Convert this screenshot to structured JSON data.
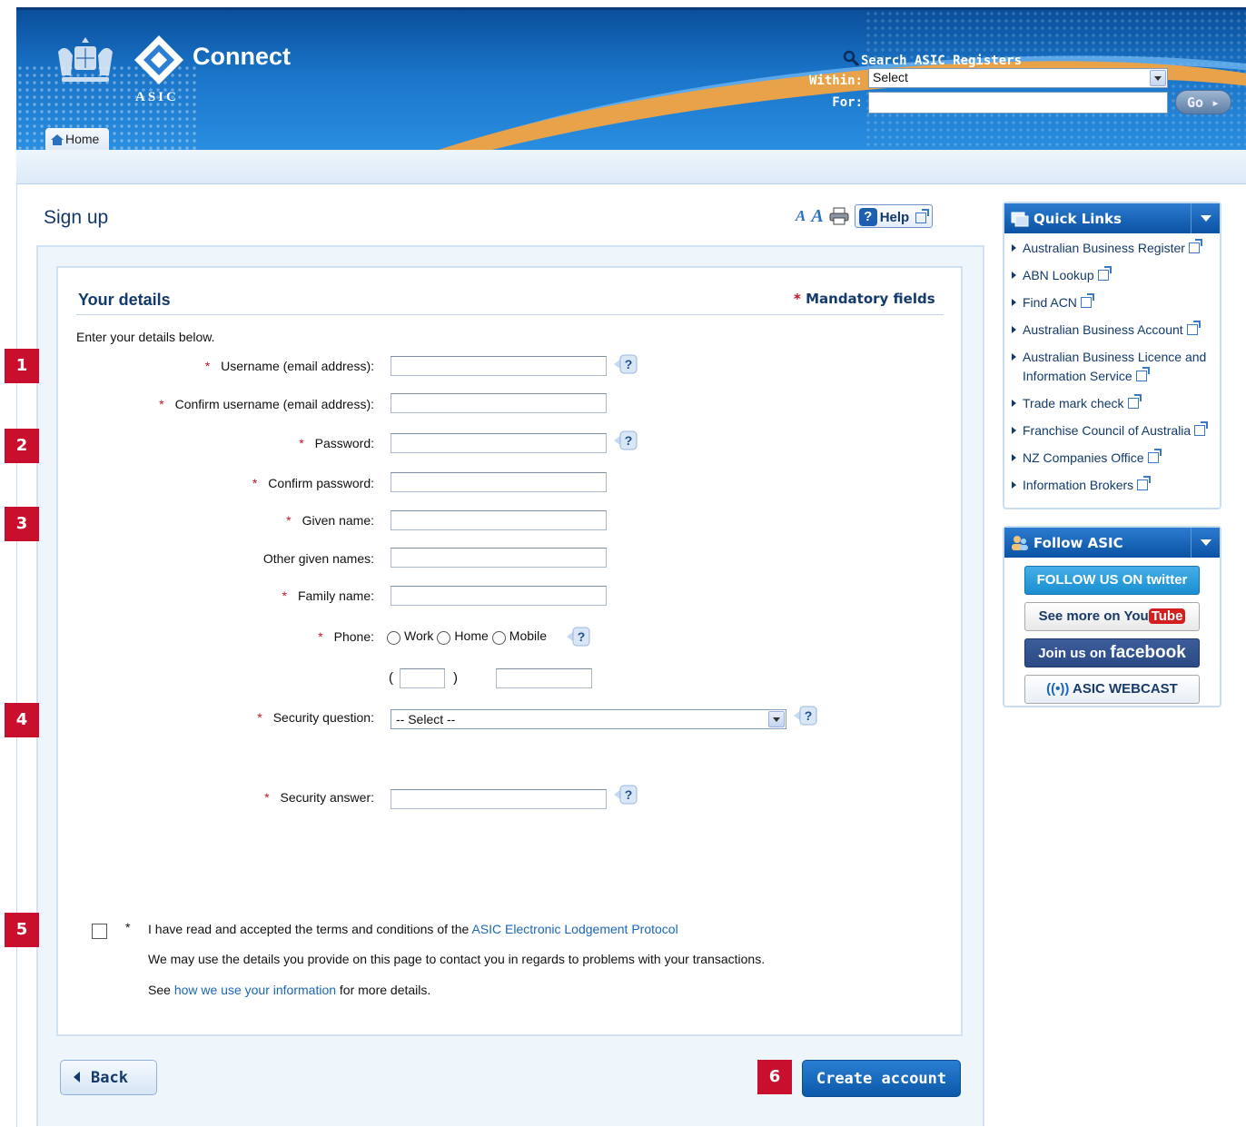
{
  "header": {
    "app_title": "Connect",
    "org": "ASIC",
    "home_tab": "Home",
    "search": {
      "title": "Search ASIC Registers",
      "within_label": "Within:",
      "within_value": "Select",
      "for_label": "For:",
      "for_value": "",
      "go_label": "Go"
    }
  },
  "page": {
    "title": "Sign up",
    "help_label": "Help"
  },
  "form": {
    "section_title": "Your details",
    "mandatory_star": "*",
    "mandatory_label": "Mandatory fields",
    "intro": "Enter your details below.",
    "req": "*",
    "username_label": "Username (email address):",
    "confirm_username_label": "Confirm username (email address):",
    "password_label": "Password:",
    "confirm_password_label": "Confirm password:",
    "given_name_label": "Given name:",
    "other_given_names_label": "Other given names:",
    "family_name_label": "Family name:",
    "phone_label": "Phone:",
    "phone_options": [
      "Work",
      "Home",
      "Mobile"
    ],
    "paren_open": "(",
    "paren_close": ")",
    "security_question_label": "Security question:",
    "security_question_value": "-- Select --",
    "security_answer_label": "Security answer:",
    "terms_text": "I have read and accepted the terms and conditions of the",
    "terms_link": "ASIC Electronic Lodgement Protocol",
    "contact_note": "We may use the details you provide on this page to contact you in regards to problems with your transactions.",
    "see_text": "See",
    "info_link": "how we use your information",
    "more_details": "for more details."
  },
  "buttons": {
    "back": "Back",
    "create": "Create account"
  },
  "markers": [
    "1",
    "2",
    "3",
    "4",
    "5",
    "6"
  ],
  "sidebar": {
    "quick_links_title": "Quick Links",
    "quick_links": [
      "Australian Business Register",
      "ABN Lookup",
      "Find ACN",
      "Australian Business Account",
      "Australian Business Licence and Information Service",
      "Trade mark check",
      "Franchise Council of Australia",
      "NZ Companies Office",
      "Information Brokers"
    ],
    "follow_title": "Follow ASIC",
    "twitter": "FOLLOW US ON twitter",
    "youtube_text": "See more on",
    "youtube_you": "You",
    "youtube_tube": "Tube",
    "facebook_text": "Join us on",
    "facebook_brand": "facebook",
    "webcast": "ASIC WEBCAST"
  },
  "colors": {
    "header_blue": "#1a74c8",
    "accent_orange": "#e8a24a",
    "required_red": "#c8102e",
    "title_navy": "#133a6b",
    "link_blue": "#1a66b8"
  }
}
